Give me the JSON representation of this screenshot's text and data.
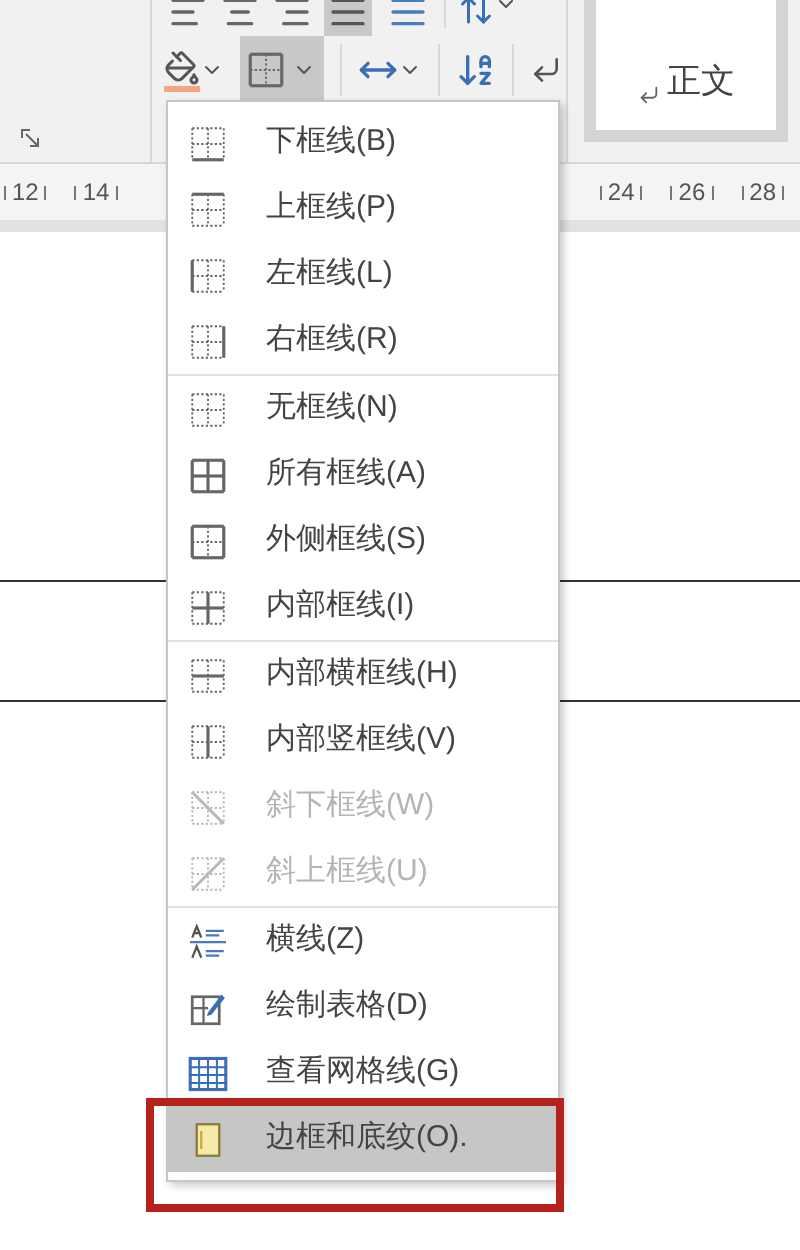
{
  "ribbon": {
    "border_button": {
      "pressed": true
    },
    "style_gallery": {
      "label": "正文"
    }
  },
  "ruler": {
    "left_numbers": [
      "12",
      "14"
    ],
    "right_numbers": [
      "24",
      "26",
      "28"
    ]
  },
  "menu": {
    "sections": [
      {
        "items": [
          {
            "kind": "bottom",
            "label": "下框线(B)",
            "disabled": false,
            "selected": false,
            "outlined": false
          },
          {
            "kind": "top",
            "label": "上框线(P)",
            "disabled": false,
            "selected": false,
            "outlined": false
          },
          {
            "kind": "left",
            "label": "左框线(L)",
            "disabled": false,
            "selected": false,
            "outlined": false
          },
          {
            "kind": "right",
            "label": "右框线(R)",
            "disabled": false,
            "selected": false,
            "outlined": false
          }
        ]
      },
      {
        "items": [
          {
            "kind": "none",
            "label": "无框线(N)",
            "disabled": false,
            "selected": false,
            "outlined": false
          },
          {
            "kind": "all",
            "label": "所有框线(A)",
            "disabled": false,
            "selected": false,
            "outlined": false
          },
          {
            "kind": "outside",
            "label": "外侧框线(S)",
            "disabled": false,
            "selected": false,
            "outlined": false
          },
          {
            "kind": "inside",
            "label": "内部框线(I)",
            "disabled": false,
            "selected": false,
            "outlined": false
          }
        ]
      },
      {
        "items": [
          {
            "kind": "inside_h",
            "label": "内部横框线(H)",
            "disabled": false,
            "selected": false,
            "outlined": false
          },
          {
            "kind": "inside_v",
            "label": "内部竖框线(V)",
            "disabled": false,
            "selected": false,
            "outlined": false
          },
          {
            "kind": "diag_down",
            "label": "斜下框线(W)",
            "disabled": true,
            "selected": false,
            "outlined": false
          },
          {
            "kind": "diag_up",
            "label": "斜上框线(U)",
            "disabled": true,
            "selected": false,
            "outlined": false
          }
        ]
      },
      {
        "items": [
          {
            "kind": "hline",
            "label": "横线(Z)",
            "disabled": false,
            "selected": false,
            "outlined": false
          },
          {
            "kind": "draw",
            "label": "绘制表格(D)",
            "disabled": false,
            "selected": false,
            "outlined": false
          },
          {
            "kind": "grid",
            "label": "查看网格线(G)",
            "disabled": false,
            "selected": false,
            "outlined": false
          },
          {
            "kind": "shading",
            "label": "边框和底纹(O).",
            "disabled": false,
            "selected": true,
            "outlined": true
          }
        ]
      }
    ]
  }
}
